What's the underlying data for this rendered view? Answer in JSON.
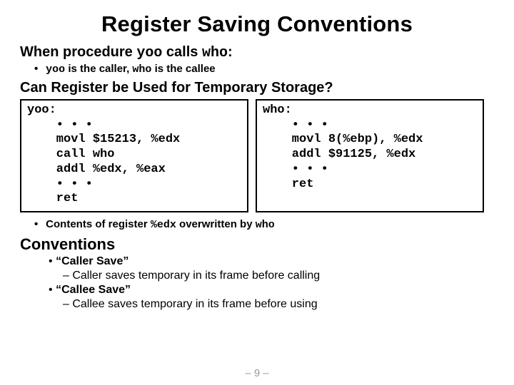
{
  "title": "Register Saving Conventions",
  "line1_a": "When procedure ",
  "line1_b": "yoo",
  "line1_c": " calls ",
  "line1_d": "who",
  "line1_e": ":",
  "bullet1_a": "yoo",
  "bullet1_b": " is the caller, ",
  "bullet1_c": "who",
  "bullet1_d": " is the callee",
  "h2q": "Can Register be Used for Temporary Storage?",
  "code_yoo": "yoo:\n    • • •\n    movl $15213, %edx\n    call who\n    addl %edx, %eax\n    • • •\n    ret",
  "code_who": "who:\n    • • •\n    movl 8(%ebp), %edx\n    addl $91125, %edx\n    • • •\n    ret",
  "bullet2_a": "Contents of register ",
  "bullet2_b": "%edx",
  "bullet2_c": " overwritten by ",
  "bullet2_d": "who",
  "h2c": "Conventions",
  "conv1": "“Caller Save”",
  "conv1sub": "– Caller saves temporary in its frame before calling",
  "conv2": "“Callee Save”",
  "conv2sub": "– Callee saves temporary in its frame before using",
  "pagenum": "– 9 –",
  "dot": "•"
}
